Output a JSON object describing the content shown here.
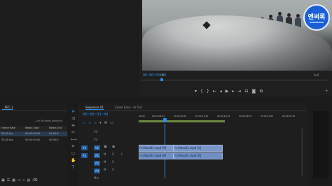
{
  "program": {
    "fit": "Fit",
    "full": "Full",
    "timecode": "00:00:03:08"
  },
  "badge": {
    "line1": "엔써록",
    "line2": "SOOMSOOK"
  },
  "project": {
    "tab": "...PET_1",
    "selection": "1 of 36 items selected",
    "columns": [
      "Frame Rate",
      "Media Start",
      "Media End"
    ],
    "rows": [
      [
        "30.00 fps",
        "00:00:00:00",
        "00:00:0"
      ],
      [
        "30.00 fps",
        "00:00:00:00",
        "00:00:0"
      ]
    ]
  },
  "timeline": {
    "tab": "Sequence 01",
    "tab2": "Zoom Ease - In Out",
    "timecode": "00:00:03:08",
    "ruler": [
      "00:00",
      "00:00:04:23",
      "00:00:09:23",
      "00:00:14:23",
      "00:00:19:23",
      "00:00:24:23",
      "00:00:29:23",
      "00:00:34:23"
    ],
    "tracks": {
      "v3": "V3",
      "v2": "V2",
      "v1": "V1",
      "a1": "A1",
      "a2": "A2",
      "a3": "A3",
      "mix": "Mix"
    },
    "clips": {
      "v1a": "fx Volvo01.mp4 [V]",
      "v1b": "fx Volvo01.mp4 [V]",
      "a1a": "fx Volvo01.mp4 [A]",
      "a1b": "fx Volvo01.mp4 [A]"
    }
  },
  "colors": {
    "accent": "#2d8ceb",
    "clip": "#7b97c9"
  }
}
